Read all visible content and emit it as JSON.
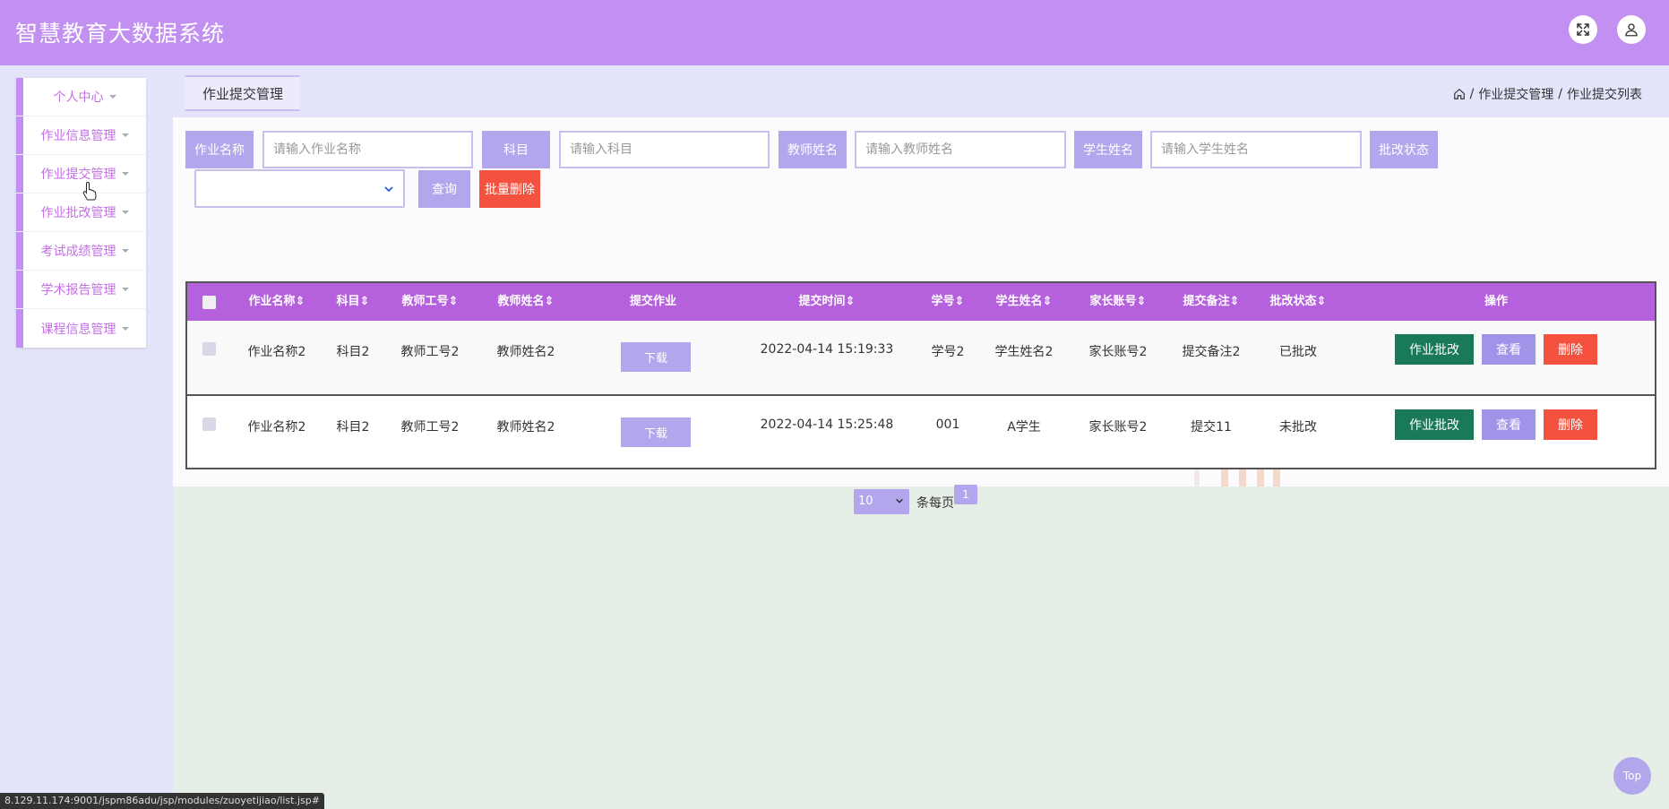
{
  "header": {
    "title": "智慧教育大数据系统",
    "fullscreen_icon": "fullscreen-icon",
    "user_icon": "user-icon"
  },
  "sidebar": {
    "items": [
      {
        "label": "个人中心"
      },
      {
        "label": "作业信息管理"
      },
      {
        "label": "作业提交管理"
      },
      {
        "label": "作业批改管理"
      },
      {
        "label": "考试成绩管理"
      },
      {
        "label": "学术报告管理"
      },
      {
        "label": "课程信息管理"
      }
    ]
  },
  "page": {
    "tab": "作业提交管理",
    "breadcrumb": {
      "home_icon": "home-icon",
      "items": [
        "作业提交管理",
        "作业提交列表"
      ],
      "separator": "/"
    }
  },
  "search": {
    "fields": [
      {
        "label": "作业名称",
        "placeholder": "请输入作业名称",
        "value": ""
      },
      {
        "label": "科目",
        "placeholder": "请输入科目",
        "value": ""
      },
      {
        "label": "教师姓名",
        "placeholder": "请输入教师姓名",
        "value": ""
      },
      {
        "label": "学生姓名",
        "placeholder": "请输入学生姓名",
        "value": ""
      }
    ],
    "status_label": "批改状态",
    "status_value": "",
    "query_label": "查询",
    "batch_delete_label": "批量删除"
  },
  "table": {
    "columns": [
      "作业名称",
      "科目",
      "教师工号",
      "教师姓名",
      "提交作业",
      "提交时间",
      "学号",
      "学生姓名",
      "家长账号",
      "提交备注",
      "批改状态",
      "操作"
    ],
    "sort_glyph": "⇕",
    "download_label": "下载",
    "actions": {
      "review": "作业批改",
      "view": "查看",
      "delete": "删除"
    },
    "rows": [
      {
        "name": "作业名称2",
        "subject": "科目2",
        "teacher_id": "教师工号2",
        "teacher_name": "教师姓名2",
        "time": "2022-04-14 15:19:33",
        "student_id": "学号2",
        "student_name": "学生姓名2",
        "parent": "家长账号2",
        "remark": "提交备注2",
        "status": "已批改"
      },
      {
        "name": "作业名称2",
        "subject": "科目2",
        "teacher_id": "教师工号2",
        "teacher_name": "教师姓名2",
        "time": "2022-04-14 15:25:48",
        "student_id": "001",
        "student_name": "A学生",
        "parent": "家长账号2",
        "remark": "提交11",
        "status": "未批改"
      }
    ]
  },
  "pagination": {
    "page_size": "10",
    "page_size_label": "条每页",
    "current_page": "1"
  },
  "top_button": "Top",
  "status_url": "8.129.11.174:9001/jspm86adu/jsp/modules/zuoyetijiao/list.jsp#",
  "colors": {
    "header": "#c290f1",
    "accent": "#b2a7ed",
    "table_head": "#b561de",
    "danger": "#f5513f",
    "review": "#1a7a58",
    "menu_text": "#c36fe6"
  }
}
